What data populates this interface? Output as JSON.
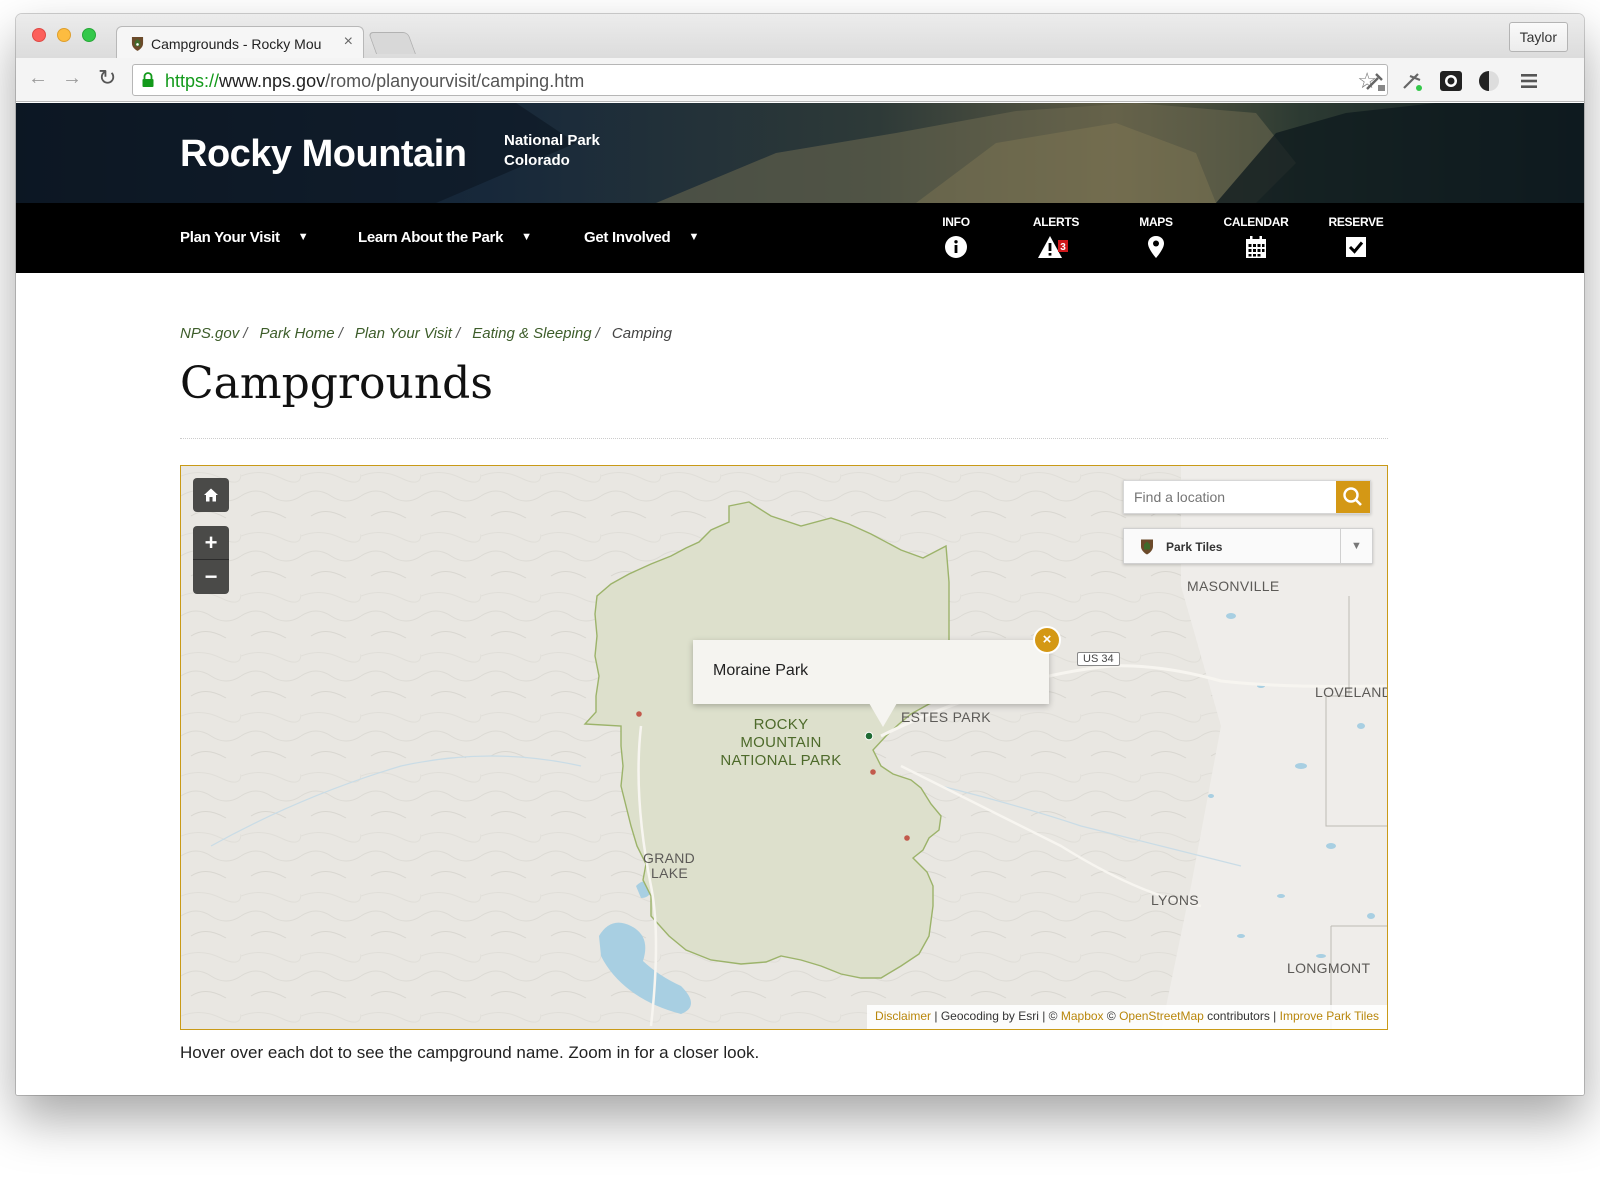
{
  "browser": {
    "tab_title": "Campgrounds - Rocky Mou",
    "tab_close": "×",
    "profile_name": "Taylor",
    "url_scheme": "https://",
    "url_host": "www.nps.gov",
    "url_path": "/romo/planyourvisit/camping.htm"
  },
  "header": {
    "park_name": "Rocky Mountain",
    "park_type": "National Park",
    "park_state": "Colorado"
  },
  "nav": {
    "items": [
      {
        "label": "Plan Your Visit"
      },
      {
        "label": "Learn About the Park"
      },
      {
        "label": "Get Involved"
      }
    ],
    "caret": "▼",
    "utilities": {
      "info": "INFO",
      "alerts": "ALERTS",
      "alerts_count": "3",
      "maps": "MAPS",
      "calendar": "CALENDAR",
      "reserve": "RESERVE"
    }
  },
  "breadcrumb": {
    "items": [
      "NPS.gov",
      "Park Home",
      "Plan Your Visit",
      "Eating & Sleeping"
    ],
    "separator": "/",
    "current": "Camping"
  },
  "page": {
    "title": "Campgrounds",
    "caption": "Hover over each dot to see the campground name. Zoom in for a closer look."
  },
  "map": {
    "search_placeholder": "Find a location",
    "layer_selected": "Park Tiles",
    "zoom_in": "+",
    "zoom_out": "−",
    "popup_title": "Moraine Park",
    "popup_close": "×",
    "park_label_line1": "ROCKY",
    "park_label_line2": "MOUNTAIN",
    "park_label_line3": "NATIONAL PARK",
    "places": {
      "masonville": "MASONVILLE",
      "loveland": "LOVELAND",
      "estes_park": "ESTES PARK",
      "grand_lake_1": "GRAND",
      "grand_lake_2": "LAKE",
      "lyons": "LYONS",
      "longmont": "LONGMONT"
    },
    "road_shield": "US 34",
    "attribution": {
      "disclaimer": "Disclaimer",
      "geocoding": " | Geocoding by Esri | © ",
      "mapbox": "Mapbox",
      "copy": " © ",
      "osm": "OpenStreetMap",
      "contributors": " contributors | ",
      "improve": "Improve Park Tiles"
    },
    "colors": {
      "accent": "#d49815",
      "park_fill": "#dde0cc",
      "park_border": "#9cb36a",
      "campground_selected": "#1f6b33",
      "campground": "#c25a4c"
    }
  }
}
